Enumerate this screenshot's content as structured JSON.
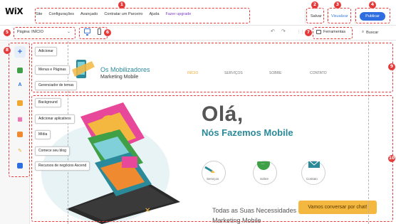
{
  "topbar": {
    "logo": "WiX",
    "menu": [
      "Site",
      "Configurações",
      "Avançado",
      "Contratar um Parceiro",
      "Ajuda"
    ],
    "upgrade": "Fazer upgrade",
    "save": "Salvar",
    "preview": "Visualizar",
    "publish": "Publicar"
  },
  "toolbar": {
    "page": "Página: INÍCIO",
    "tools": "Ferramentas",
    "search": "Buscar"
  },
  "sidebar": {
    "items": [
      {
        "label": "Adicionar",
        "icon": "plus-icon",
        "color": "#2f6ee0"
      },
      {
        "label": "Menus e Páginas",
        "icon": "pages-icon",
        "color": "#3fa048"
      },
      {
        "label": "Gerenciador de temas",
        "icon": "theme-icon",
        "color": "#2f6ee0"
      },
      {
        "label": "Background",
        "icon": "background-icon",
        "color": "#f0a830"
      },
      {
        "label": "Adicionar aplicativos",
        "icon": "apps-icon",
        "color": "#e8489a"
      },
      {
        "label": "Mídia",
        "icon": "media-icon",
        "color": "#f08a30"
      },
      {
        "label": "Comece seu blog",
        "icon": "blog-icon",
        "color": "#f0a830"
      },
      {
        "label": "Recursos de negócios Ascend",
        "icon": "ascend-icon",
        "color": "#2f6ee0"
      }
    ]
  },
  "site": {
    "brand_title": "Os Mobilizadores",
    "brand_sub": "Marketing Mobile",
    "nav": [
      "INÍCIO",
      "SERVIÇOS",
      "SOBRE",
      "CONTATO"
    ],
    "headline": "Olá,",
    "subheadline": "Nós Fazemos Mobile",
    "circles": [
      "Serviços",
      "Sobre",
      "Contato"
    ],
    "bottom_line1": "Todas as Suas Necessidades de",
    "bottom_line2": "Marketing Mobile",
    "chat": "Vamos conversar por chat!"
  },
  "badges": [
    "1",
    "2",
    "3",
    "4",
    "5",
    "6",
    "7",
    "8",
    "9",
    "10"
  ],
  "colors": {
    "accent": "#2f6ee0",
    "annotation": "#e53a3a",
    "brand": "#2b8a9a",
    "chat": "#f4b73f"
  }
}
